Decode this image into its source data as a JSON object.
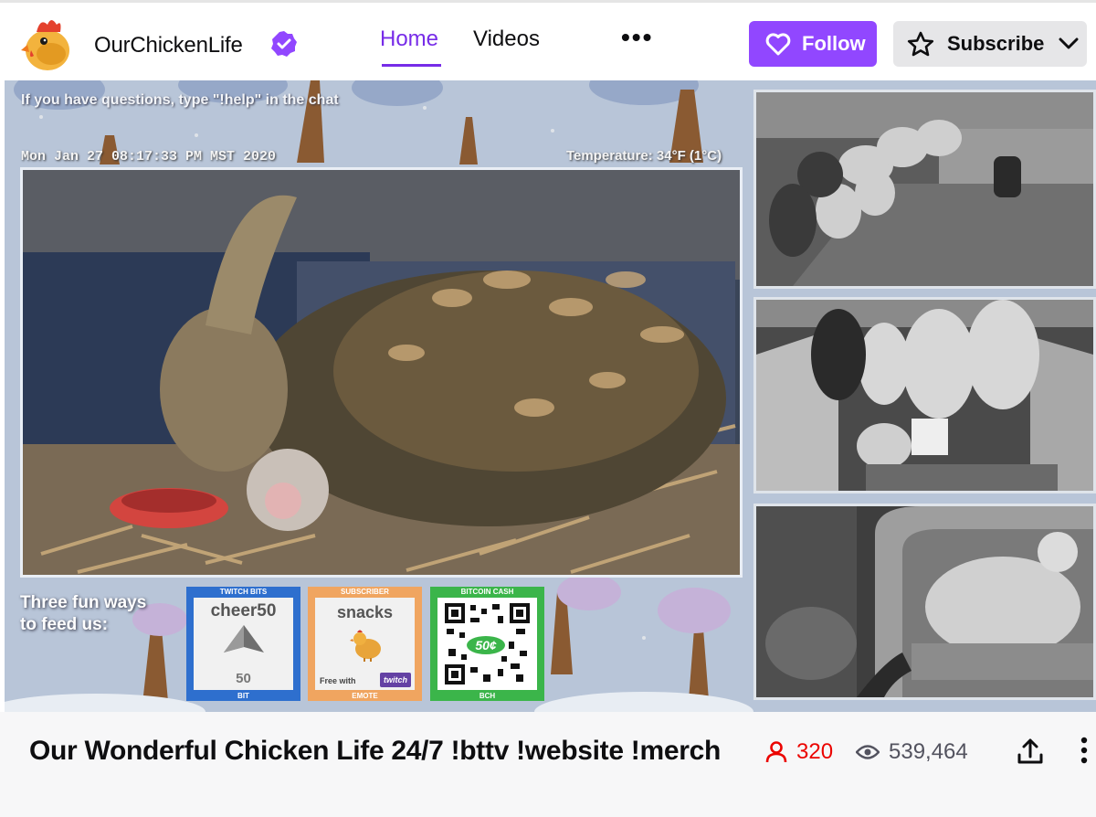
{
  "header": {
    "channel_name": "OurChickenLife",
    "nav": {
      "home": "Home",
      "videos": "Videos",
      "more": "•••"
    },
    "follow_label": "Follow",
    "subscribe_label": "Subscribe"
  },
  "stream_overlay": {
    "help_text": "If you have questions, type \"!help\" in the chat",
    "timestamp": "Mon Jan 27 08:17:33 PM MST 2020",
    "temperature": "Temperature: 34°F (1°C)",
    "feed_text_line1": "Three fun ways",
    "feed_text_line2": "to feed us:",
    "cards": {
      "bits": {
        "top": "TWITCH BITS",
        "title": "cheer50",
        "number": "50",
        "bottom": "BIT"
      },
      "snacks": {
        "top": "SUBSCRIBER",
        "title": "snacks",
        "free_with": "Free with",
        "badge": "twitch",
        "bottom": "EMOTE"
      },
      "bch": {
        "top": "BITCOIN CASH",
        "amount": "50¢",
        "bottom": "BCH"
      }
    }
  },
  "info": {
    "title": "Our Wonderful Chicken Life 24/7 !bttv !website !merch",
    "viewers": "320",
    "views": "539,464"
  },
  "colors": {
    "brand_purple": "#9147ff",
    "nav_active": "#772ce8",
    "live_red": "#eb0400"
  }
}
